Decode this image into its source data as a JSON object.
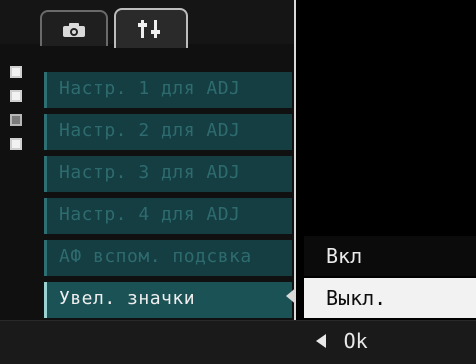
{
  "tabs": [
    {
      "icon": "camera-icon"
    },
    {
      "icon": "setup-icon"
    }
  ],
  "menu": {
    "items": [
      {
        "label": "Настр. 1 для ADJ"
      },
      {
        "label": "Настр. 2 для ADJ"
      },
      {
        "label": "Настр. 3 для ADJ"
      },
      {
        "label": "Настр. 4 для ADJ"
      },
      {
        "label": "АФ вспом. подсвка"
      },
      {
        "label": "Увел. значки"
      }
    ],
    "selected_index": 5
  },
  "submenu": {
    "options": [
      {
        "label": "Вкл"
      },
      {
        "label": "Выкл."
      }
    ],
    "selected_index": 1
  },
  "footer": {
    "ok_label": "Ok"
  },
  "colors": {
    "menu_bg": "#143e42",
    "menu_selected_bg": "#1b5256",
    "submenu_selected_bg": "#f2f2f2"
  }
}
